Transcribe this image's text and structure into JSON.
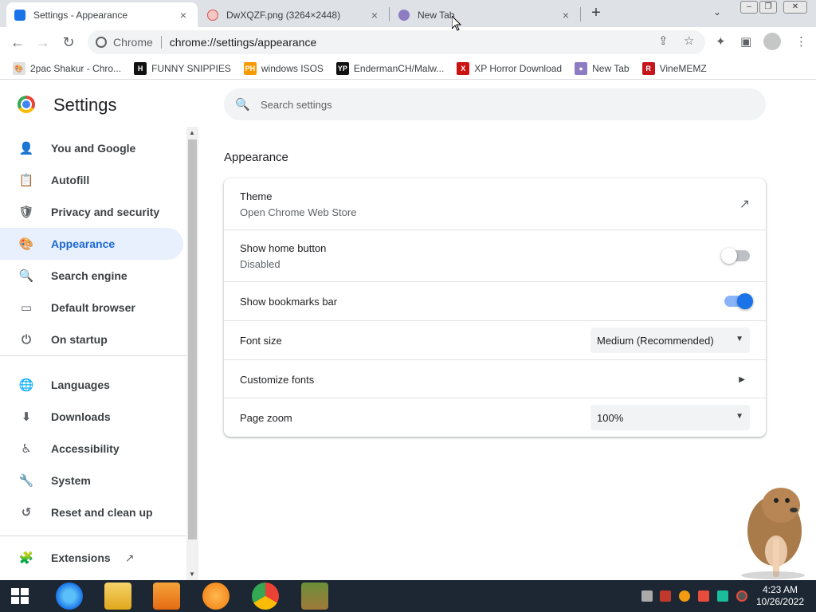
{
  "tabs": [
    {
      "title": "Settings - Appearance",
      "close": "×"
    },
    {
      "title": "DwXQZF.png (3264×2448)",
      "close": "×"
    },
    {
      "title": "New Tab",
      "close": "×"
    }
  ],
  "tabstrip": {
    "new_tab": "+",
    "tab_search": "⌄"
  },
  "window_controls": {
    "minimize": "‒",
    "maximize": "❐",
    "close": "✕"
  },
  "toolbar": {
    "back": "←",
    "forward": "→",
    "reload": "↻",
    "origin": "Chrome",
    "url": "chrome://settings/appearance",
    "share_icon": "⇪",
    "bookmark_icon": "☆",
    "extensions_icon": "✦",
    "sidepanel_icon": "▣",
    "menu_icon": "⋮"
  },
  "bookmarks": [
    {
      "label": "2pac Shakur - Chro...",
      "icon": "🎨",
      "color": "#e0e0e0"
    },
    {
      "label": "FUNNY SNIPPIES",
      "icon": "H",
      "color": "#111111"
    },
    {
      "label": "windows ISOS",
      "icon": "PH",
      "color": "#f79a00"
    },
    {
      "label": "EndermanCH/Malw...",
      "icon": "YP",
      "color": "#111111"
    },
    {
      "label": "XP Horror Download",
      "icon": "X",
      "color": "#cc1111"
    },
    {
      "label": "New Tab",
      "icon": "●",
      "color": "#8e7cc3"
    },
    {
      "label": "VineMEMZ",
      "icon": "R",
      "color": "#c4161c"
    }
  ],
  "settings": {
    "title": "Settings",
    "search_placeholder": "Search settings",
    "search_icon": "🔍"
  },
  "sidebar": {
    "items": [
      {
        "label": "You and Google",
        "icon": "person-icon",
        "glyph": "👤"
      },
      {
        "label": "Autofill",
        "icon": "clipboard-icon",
        "glyph": "📋"
      },
      {
        "label": "Privacy and security",
        "icon": "shield-icon",
        "glyph": "🛡"
      },
      {
        "label": "Appearance",
        "icon": "palette-icon",
        "glyph": "🎨",
        "active": true
      },
      {
        "label": "Search engine",
        "icon": "search-icon",
        "glyph": "🔍"
      },
      {
        "label": "Default browser",
        "icon": "browser-window-icon",
        "glyph": "▭"
      },
      {
        "label": "On startup",
        "icon": "power-icon",
        "glyph": "⏻"
      },
      {
        "label": "Languages",
        "icon": "globe-icon",
        "glyph": "🌐"
      },
      {
        "label": "Downloads",
        "icon": "download-icon",
        "glyph": "⬇"
      },
      {
        "label": "Accessibility",
        "icon": "accessibility-icon",
        "glyph": "♿"
      },
      {
        "label": "System",
        "icon": "wrench-icon",
        "glyph": "🔧"
      },
      {
        "label": "Reset and clean up",
        "icon": "history-icon",
        "glyph": "↺"
      },
      {
        "label": "Extensions",
        "icon": "puzzle-icon",
        "glyph": "🧩",
        "trailing": "↗"
      }
    ]
  },
  "appearance": {
    "section_title": "Appearance",
    "theme": {
      "label": "Theme",
      "sub": "Open Chrome Web Store",
      "action_icon": "↗"
    },
    "home_button": {
      "label": "Show home button",
      "sub": "Disabled",
      "enabled": false
    },
    "bookmarks_bar": {
      "label": "Show bookmarks bar",
      "enabled": true
    },
    "font_size": {
      "label": "Font size",
      "value": "Medium (Recommended)",
      "arrow": "▼"
    },
    "customize_fonts": {
      "label": "Customize fonts",
      "arrow": "▶"
    },
    "page_zoom": {
      "label": "Page zoom",
      "value": "100%",
      "arrow": "▼"
    }
  },
  "taskbar": {
    "time": "4:23 AM",
    "date": "10/26/2022",
    "apps": [
      "internet-explorer-icon",
      "file-explorer-icon",
      "media-player-icon",
      "uc-browser-icon",
      "chrome-icon",
      "bonzi-icon"
    ]
  },
  "colors": {
    "accent": "#1a73e8",
    "active_nav_bg": "#e8f0fe",
    "taskbar": "#1c2733"
  }
}
